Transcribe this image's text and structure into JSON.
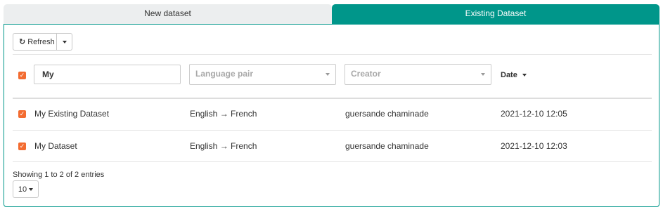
{
  "tabs": [
    {
      "label": "New dataset",
      "active": false
    },
    {
      "label": "Existing Dataset",
      "active": true
    }
  ],
  "toolbar": {
    "refresh_label": "Refresh",
    "refresh_icon": "refresh-icon"
  },
  "filters": {
    "search_value": "My",
    "language_pair_placeholder": "Language pair",
    "creator_placeholder": "Creator",
    "date_header": "Date",
    "select_all_checked": true
  },
  "rows": [
    {
      "checked": true,
      "name": "My Existing Dataset",
      "language_pair": "English → French",
      "creator": "guersande chaminade",
      "date": "2021-12-10 12:05"
    },
    {
      "checked": true,
      "name": "My Dataset",
      "language_pair": "English → French",
      "creator": "guersande chaminade",
      "date": "2021-12-10 12:03"
    }
  ],
  "footer": {
    "info": "Showing 1 to 2 of 2 entries",
    "page_length": "10"
  },
  "colors": {
    "accent": "#00968a",
    "checkbox": "#f36c31",
    "tab_inactive": "#eceeef"
  }
}
